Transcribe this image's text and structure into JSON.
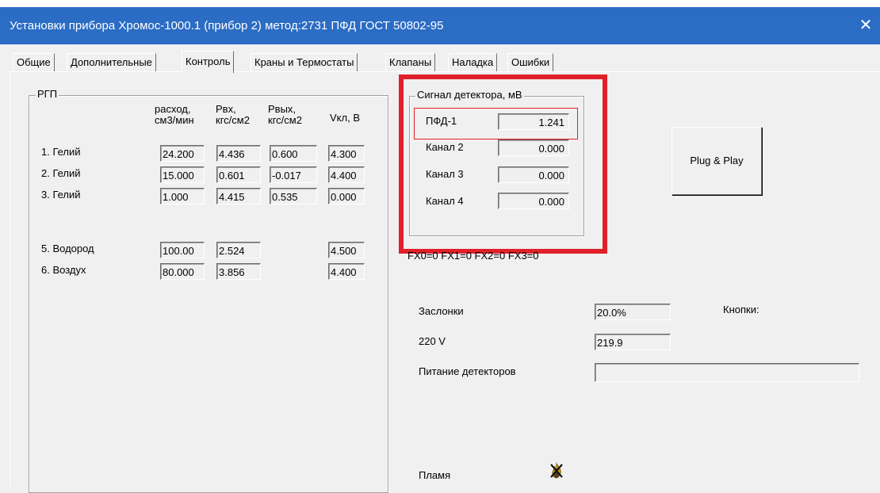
{
  "window": {
    "title": "Установки прибора Хромос-1000.1  (прибор 2) метод:2731 ПФД ГОСТ 50802-95",
    "close_glyph": "✕"
  },
  "tabs": [
    {
      "label": "Общие"
    },
    {
      "label": "Дополнительные"
    },
    {
      "label": "Контроль",
      "active": true
    },
    {
      "label": "Краны и Термостаты"
    },
    {
      "label": "Клапаны"
    },
    {
      "label": "Наладка"
    },
    {
      "label": "Ошибки"
    }
  ],
  "rgp": {
    "group_label": "РГП",
    "headers": {
      "flow_1": "расход,",
      "flow_2": "см3/мин",
      "pin_1": "Рвх,",
      "pin_2": "кгс/см2",
      "pout_1": "Рвых,",
      "pout_2": "кгс/см2",
      "vkl": "Vкл, В"
    },
    "rows": [
      {
        "label": "1. Гелий",
        "flow": "24.200",
        "pin": "4.436",
        "pout": "0.600",
        "v": "4.300"
      },
      {
        "label": "2. Гелий",
        "flow": "15.000",
        "pin": "0.601",
        "pout": "-0.017",
        "v": "4.400"
      },
      {
        "label": "3. Гелий",
        "flow": "1.000",
        "pin": "4.415",
        "pout": "0.535",
        "v": "0.000"
      },
      {
        "label": "5. Водород",
        "flow": "100.00",
        "pin": "2.524",
        "v": "4.500"
      },
      {
        "label": "6. Воздух",
        "flow": "80.000",
        "pin": "3.856",
        "v": "4.400"
      }
    ]
  },
  "signal": {
    "group_label": "Сигнал детектора, мВ",
    "channels": [
      {
        "label": "ПФД-1",
        "value": "1.241"
      },
      {
        "label": "Канал 2",
        "value": "0.000"
      },
      {
        "label": "Канал 3",
        "value": "0.000"
      },
      {
        "label": "Канал 4",
        "value": "0.000"
      }
    ]
  },
  "plug_play_label": "Plug & Play",
  "fx_text": "FX0=0  FX1=0  FX2=0 FX3=0",
  "status": {
    "zaslonki_label": "Заслонки",
    "zaslonki_value": "20.0%",
    "v220_label": "220 V",
    "v220_value": "219.9",
    "pitanie_label": "Питание детекторов",
    "pitanie_value": "",
    "knopki_label": "Кнопки:",
    "plamya_label": "Пламя"
  },
  "colors": {
    "titlebar": "#2b6cc4",
    "highlight": "#e0202a"
  }
}
